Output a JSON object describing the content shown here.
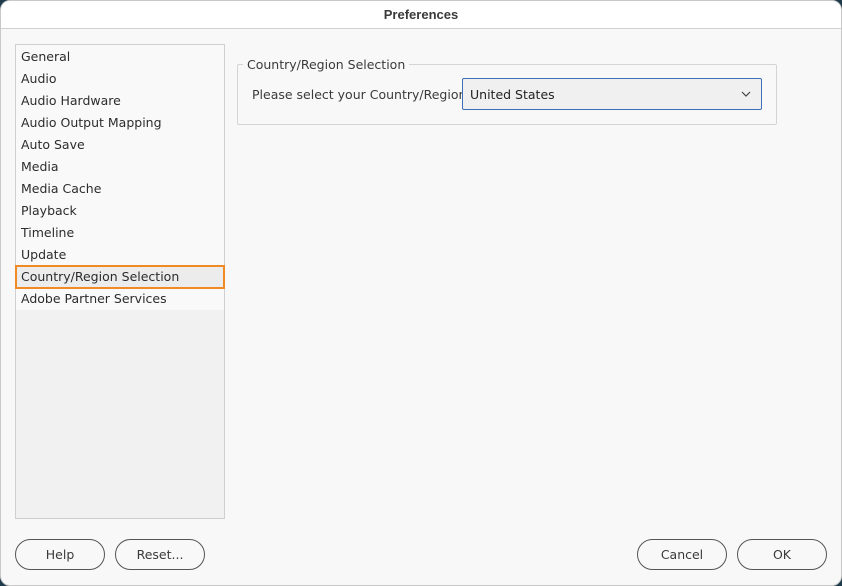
{
  "window": {
    "title": "Preferences"
  },
  "sidebar": {
    "items": [
      {
        "label": "General"
      },
      {
        "label": "Audio"
      },
      {
        "label": "Audio Hardware"
      },
      {
        "label": "Audio Output Mapping"
      },
      {
        "label": "Auto Save"
      },
      {
        "label": "Media"
      },
      {
        "label": "Media Cache"
      },
      {
        "label": "Playback"
      },
      {
        "label": "Timeline"
      },
      {
        "label": "Update"
      },
      {
        "label": "Country/Region Selection",
        "selected": true
      },
      {
        "label": "Adobe Partner Services"
      }
    ],
    "selected_index": 10,
    "highlight_color": "#f08a24"
  },
  "panel": {
    "group_title": "Country/Region Selection",
    "field_label": "Please select your Country/Region:",
    "country_select": {
      "value": "United States",
      "icon": "chevron-down-icon"
    }
  },
  "footer": {
    "help_label": "Help",
    "reset_label": "Reset...",
    "cancel_label": "Cancel",
    "ok_label": "OK"
  },
  "colors": {
    "accent_focus": "#3d6fb6",
    "selection_outline": "#f08a24"
  }
}
